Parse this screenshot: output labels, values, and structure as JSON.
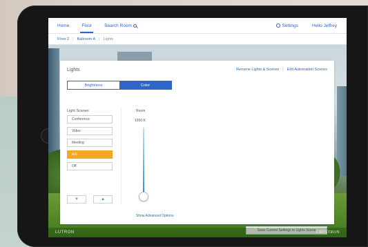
{
  "nav": {
    "home": "Home",
    "floor": "Floor",
    "search": "Search Room",
    "settings": "Settings",
    "greeting": "Hello Jeffrey"
  },
  "breadcrumb": [
    "Floor 2",
    "Ballroom A",
    "Lights"
  ],
  "panel": {
    "title": "Lights",
    "rename_link": "Rename Lights & Scenes",
    "automation_link": "Edit Automation Scenes",
    "tabs": [
      {
        "label": "Brightness",
        "active": false
      },
      {
        "label": "Color",
        "active": true
      }
    ],
    "scenes_label": "Light Scenes",
    "scenes": [
      {
        "label": "Conference",
        "active": false
      },
      {
        "label": "Video",
        "active": false
      },
      {
        "label": "Meeting",
        "active": false
      },
      {
        "label": "A/V",
        "active": true
      },
      {
        "label": "Off",
        "active": false
      }
    ],
    "room_label": "Room",
    "kelvin": "1200 K",
    "advanced_link": "Show Advanced Options",
    "save_button": "Save Current Settings to Lights Scene"
  },
  "footer": {
    "left_brand": "LUTRON",
    "right_brand": "CRESTRON"
  },
  "colors": {
    "accent": "#2c66c8",
    "active_scene": "#f5a623",
    "arrow_down": "#e8731b",
    "arrow_up": "#1b8fd6"
  },
  "icons": {
    "settings": "gear-icon",
    "search": "magnifier-icon",
    "down": "triangle-down-icon",
    "up": "triangle-up-icon"
  }
}
